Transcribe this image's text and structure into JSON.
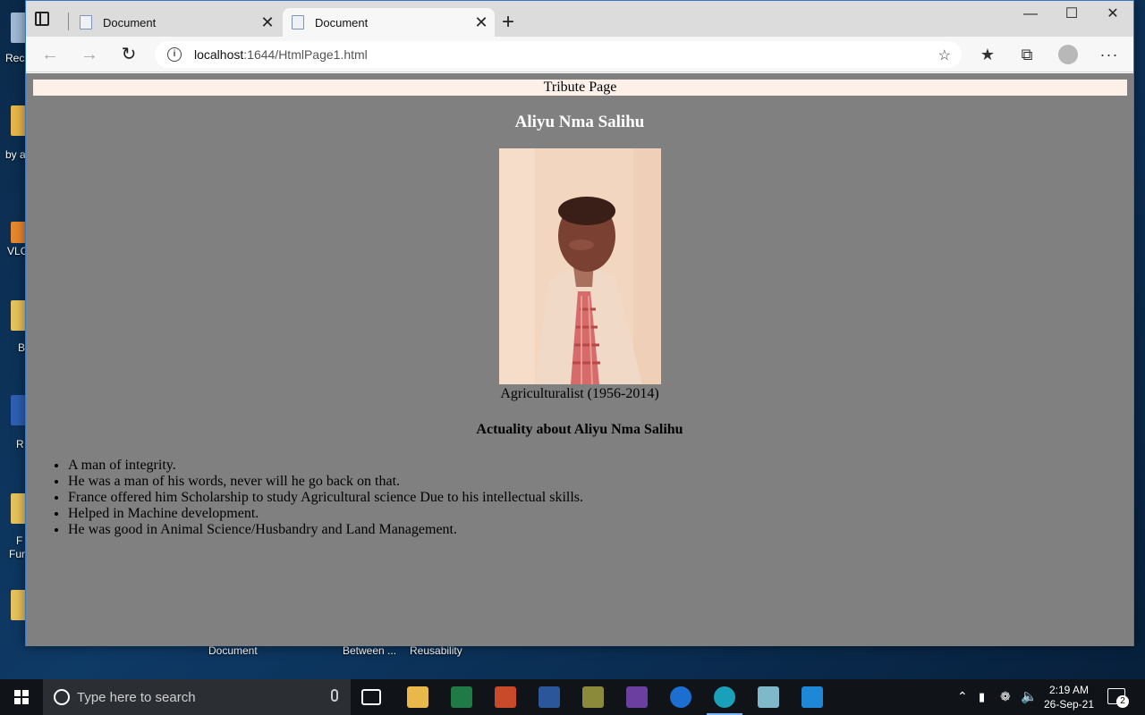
{
  "desktop": {
    "icons": [
      {
        "label": "Rec"
      },
      {
        "label": "by a"
      },
      {
        "label": "VLC"
      },
      {
        "label": "B"
      },
      {
        "label": "R"
      },
      {
        "label": "F"
      },
      {
        "label": "Fur"
      }
    ],
    "bottom_labels": [
      "Document",
      "Between ...",
      "Reusability"
    ]
  },
  "browser": {
    "tabs": [
      {
        "label": "Document"
      },
      {
        "label": "Document"
      }
    ],
    "address": {
      "host": "localhost",
      "path": ":1644/HtmlPage1.html"
    }
  },
  "page": {
    "bar_text": "Tribute Page",
    "name": "Aliyu Nma Salihu",
    "caption": "Agriculturalist (1956-2014)",
    "section_title": "Actuality about Aliyu Nma Salihu",
    "facts": [
      "A man of integrity.",
      "He was a man of his words, never will he go back on that.",
      "France offered him Scholarship to study Agricultural science Due to his intellectual skills.",
      "Helped in Machine development.",
      "He was good in Animal Science/Husbandry and Land Management."
    ]
  },
  "taskbar": {
    "search_placeholder": "Type here to search",
    "time": "2:19 AM",
    "date": "26-Sep-21",
    "notification_count": "2"
  }
}
